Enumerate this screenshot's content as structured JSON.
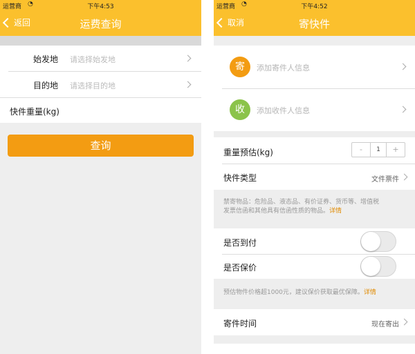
{
  "left": {
    "status": {
      "carrier": "运营商",
      "time": "下午4:53"
    },
    "nav": {
      "back": "返回",
      "title": "运费查询"
    },
    "form": {
      "origin_label": "始发地",
      "origin_placeholder": "请选择始发地",
      "dest_label": "目的地",
      "dest_placeholder": "请选择目的地",
      "weight_label": "快件重量(kg)"
    },
    "query_button": "查询"
  },
  "right": {
    "status": {
      "carrier": "运营商",
      "time": "下午4:52"
    },
    "nav": {
      "back": "取消",
      "title": "寄快件"
    },
    "sender": {
      "badge": "寄",
      "text": "添加寄件人信息",
      "color": "#f39c12"
    },
    "receiver": {
      "badge": "收",
      "text": "添加收件人信息",
      "color": "#8bc34a"
    },
    "weight": {
      "label": "重量预估(kg)",
      "minus": "-",
      "value": "1",
      "plus": "+"
    },
    "type": {
      "label": "快件类型",
      "value": "文件票件"
    },
    "prohibited_note": {
      "line1": "禁寄物品：危险品、液态品、有价证券、货币等、增值税",
      "line2": "发票信函和其他具有信函性质的物品。",
      "link": "详情"
    },
    "cod": {
      "label": "是否到付",
      "on": false
    },
    "insurance": {
      "label": "是否保价",
      "on": false
    },
    "insure_note": {
      "text": "预估物件价格超1000元，建议保价获取最优保障。",
      "link": "详情"
    },
    "send_time": {
      "label": "寄件时间",
      "value": "现在寄出"
    }
  },
  "colors": {
    "accent": "#fbc02d",
    "button": "#f39c12",
    "link": "#e08a00"
  }
}
